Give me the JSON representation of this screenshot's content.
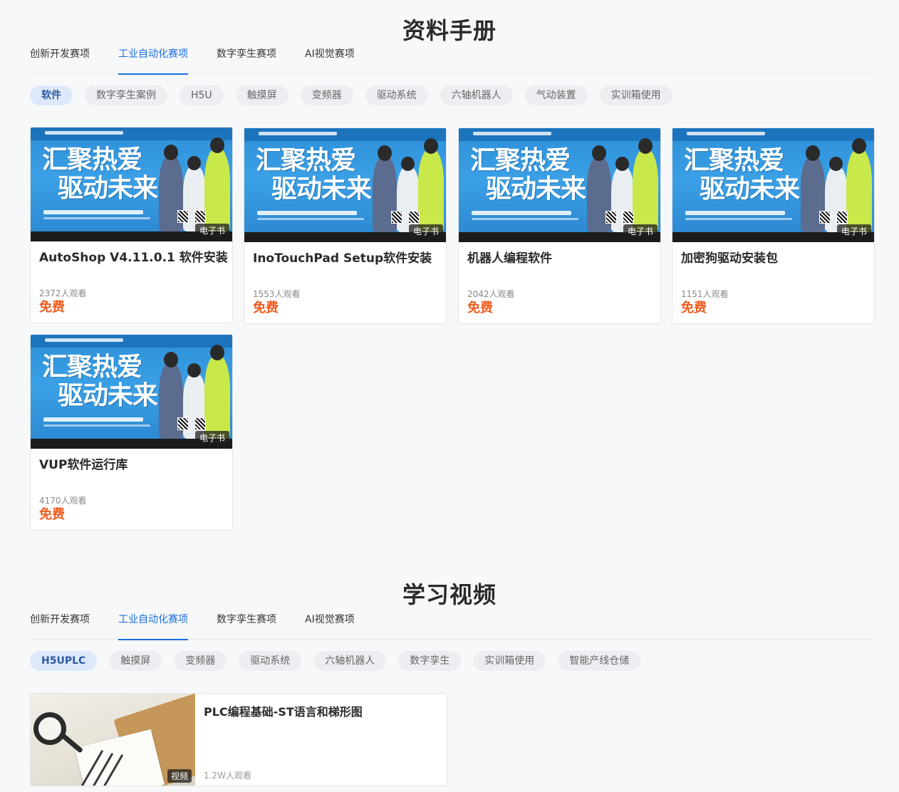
{
  "manuals": {
    "title": "资料手册",
    "tabs": [
      {
        "label": "创新开发赛项",
        "active": false
      },
      {
        "label": "工业自动化赛项",
        "active": true
      },
      {
        "label": "数字孪生赛项",
        "active": false
      },
      {
        "label": "AI视觉赛项",
        "active": false
      }
    ],
    "chips": [
      {
        "label": "软件",
        "active": true
      },
      {
        "label": "数字孪生案例",
        "active": false
      },
      {
        "label": "H5U",
        "active": false
      },
      {
        "label": "触摸屏",
        "active": false
      },
      {
        "label": "变频器",
        "active": false
      },
      {
        "label": "驱动系统",
        "active": false
      },
      {
        "label": "六轴机器人",
        "active": false
      },
      {
        "label": "气动装置",
        "active": false
      },
      {
        "label": "实训箱使用",
        "active": false
      }
    ],
    "cover": {
      "slogan_line1": "汇聚热爱",
      "slogan_line2": "驱动未来",
      "badge": "电子书"
    },
    "cards": [
      {
        "title": "AutoShop V4.11.0.1 软件安装",
        "views": "2372人观看",
        "price": "免费"
      },
      {
        "title": "InoTouchPad Setup软件安装",
        "views": "1553人观看",
        "price": "免费"
      },
      {
        "title": "机器人编程软件",
        "views": "2042人观看",
        "price": "免费"
      },
      {
        "title": "加密狗驱动安装包",
        "views": "1151人观看",
        "price": "免费"
      },
      {
        "title": "VUP软件运行库",
        "views": "4170人观看",
        "price": "免费"
      }
    ]
  },
  "videos": {
    "title": "学习视频",
    "tabs": [
      {
        "label": "创新开发赛项",
        "active": false
      },
      {
        "label": "工业自动化赛项",
        "active": true
      },
      {
        "label": "数字孪生赛项",
        "active": false
      },
      {
        "label": "AI视觉赛项",
        "active": false
      }
    ],
    "chips": [
      {
        "label": "H5UPLC",
        "active": true
      },
      {
        "label": "触摸屏",
        "active": false
      },
      {
        "label": "变频器",
        "active": false
      },
      {
        "label": "驱动系统",
        "active": false
      },
      {
        "label": "六轴机器人",
        "active": false
      },
      {
        "label": "数字孪生",
        "active": false
      },
      {
        "label": "实训箱使用",
        "active": false
      },
      {
        "label": "智能产线仓储",
        "active": false
      }
    ],
    "items": [
      {
        "title": "PLC编程基础-ST语言和梯形图",
        "views": "1.2W人观看",
        "badge": "视频"
      }
    ]
  },
  "colors": {
    "accent": "#1a6fe0",
    "price": "#f25a1c",
    "chip_active_bg": "#dde9fb"
  }
}
